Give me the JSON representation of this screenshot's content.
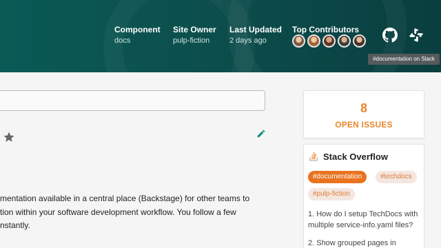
{
  "header": {
    "metadata": [
      {
        "label": "Component",
        "value": "docs"
      },
      {
        "label": "Site Owner",
        "value": "pulp-fiction"
      },
      {
        "label": "Last Updated",
        "value": "2 days ago"
      },
      {
        "label": "Top Contributors",
        "value": ""
      }
    ],
    "contributors_count": 5,
    "tooltip": "#documentation on Slack",
    "icons": [
      "github-icon",
      "slack-icon"
    ]
  },
  "content": {
    "paragraph_lines": [
      "mentation available in a central place (Backstage) for other teams to",
      "tion within your software development workflow. You follow a few",
      "nstantly."
    ]
  },
  "issues_card": {
    "count": "8",
    "label": "OPEN ISSUES"
  },
  "stack_overflow": {
    "title": "Stack Overflow",
    "tags": [
      "#documentation",
      "#techdocs",
      "#pulp-fiction"
    ],
    "questions": [
      "1. How do I setup TechDocs with multiple service-info.yaml files?",
      "2. Show grouped pages in"
    ]
  },
  "colors": {
    "accent": "#e9862e",
    "header": "#0c4f4d",
    "tag_primary": "#e9731f"
  }
}
